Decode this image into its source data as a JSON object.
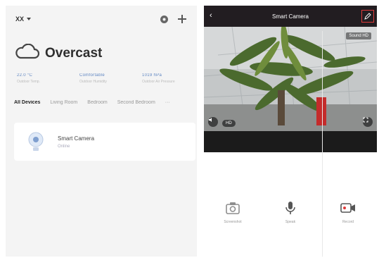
{
  "left": {
    "home_name": "XX",
    "weather": {
      "condition": "Overcast"
    },
    "stats": [
      {
        "value": "22.0 °C",
        "label": "Outdoor Temp."
      },
      {
        "value": "Comfortable",
        "label": "Outdoor Humidity"
      },
      {
        "value": "1019 hPa",
        "label": "Outdoor Air Pressure"
      }
    ],
    "tabs": [
      "All Devices",
      "Living Room",
      "Bedroom",
      "Second Bedroom",
      "···"
    ],
    "device": {
      "name": "Smart Camera",
      "status": "Online"
    }
  },
  "right": {
    "title": "Smart Camera",
    "resolution_badge": "Sound HD",
    "hd_label": "HD",
    "controls": [
      {
        "icon": "camera-icon",
        "label": "Screenshot"
      },
      {
        "icon": "microphone-icon",
        "label": "Speak"
      },
      {
        "icon": "video-record-icon",
        "label": "Record"
      }
    ]
  },
  "colors": {
    "accent": "#3d7fff",
    "header_bg": "#221d21",
    "highlight": "#e03a3a"
  }
}
